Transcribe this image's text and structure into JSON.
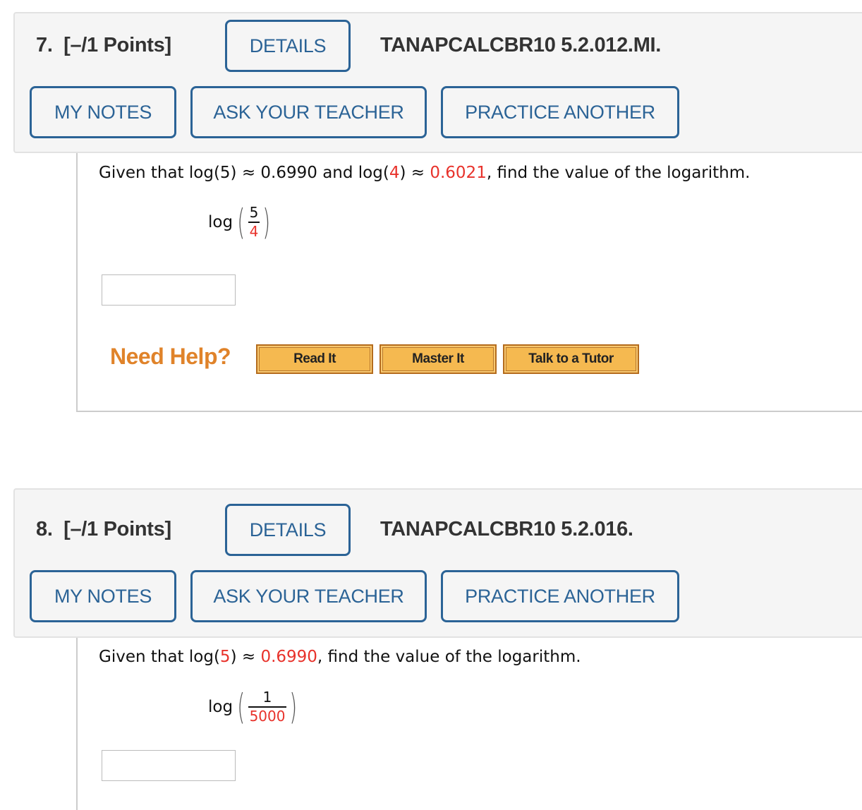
{
  "questions": [
    {
      "number_label": "7.",
      "points_label": "[–/1 Points]",
      "details_label": "DETAILS",
      "code": "TANAPCALCBR10 5.2.012.MI.",
      "my_notes_label": "MY NOTES",
      "ask_teacher_label": "ASK YOUR TEACHER",
      "practice_label": "PRACTICE ANOTHER",
      "prompt": {
        "p1": "Given that log(5) ≈ 0.6990 and log(",
        "p2": "4",
        "p3": ") ≈ ",
        "p4": "0.6021",
        "p5": ", find the value of the logarithm."
      },
      "expression": {
        "fn": "log",
        "numerator": "5",
        "denominator": "4"
      },
      "answer_value": "",
      "need_help": {
        "label": "Need Help?",
        "buttons": [
          "Read It",
          "Master It",
          "Talk to a Tutor"
        ]
      }
    },
    {
      "number_label": "8.",
      "points_label": "[–/1 Points]",
      "details_label": "DETAILS",
      "code": "TANAPCALCBR10 5.2.016.",
      "my_notes_label": "MY NOTES",
      "ask_teacher_label": "ASK YOUR TEACHER",
      "practice_label": "PRACTICE ANOTHER",
      "prompt": {
        "p1": "Given that log(",
        "p2": "5",
        "p3": ") ≈ ",
        "p4": "0.6990",
        "p5": ", find the value of the logarithm."
      },
      "expression": {
        "fn": "log",
        "numerator": "1",
        "denominator": "5000"
      },
      "answer_value": ""
    }
  ],
  "colors": {
    "button_blue": "#2b6396",
    "highlight_red": "#e8322b",
    "need_help_orange": "#e0832a",
    "help_button_fill": "#f5b950"
  }
}
